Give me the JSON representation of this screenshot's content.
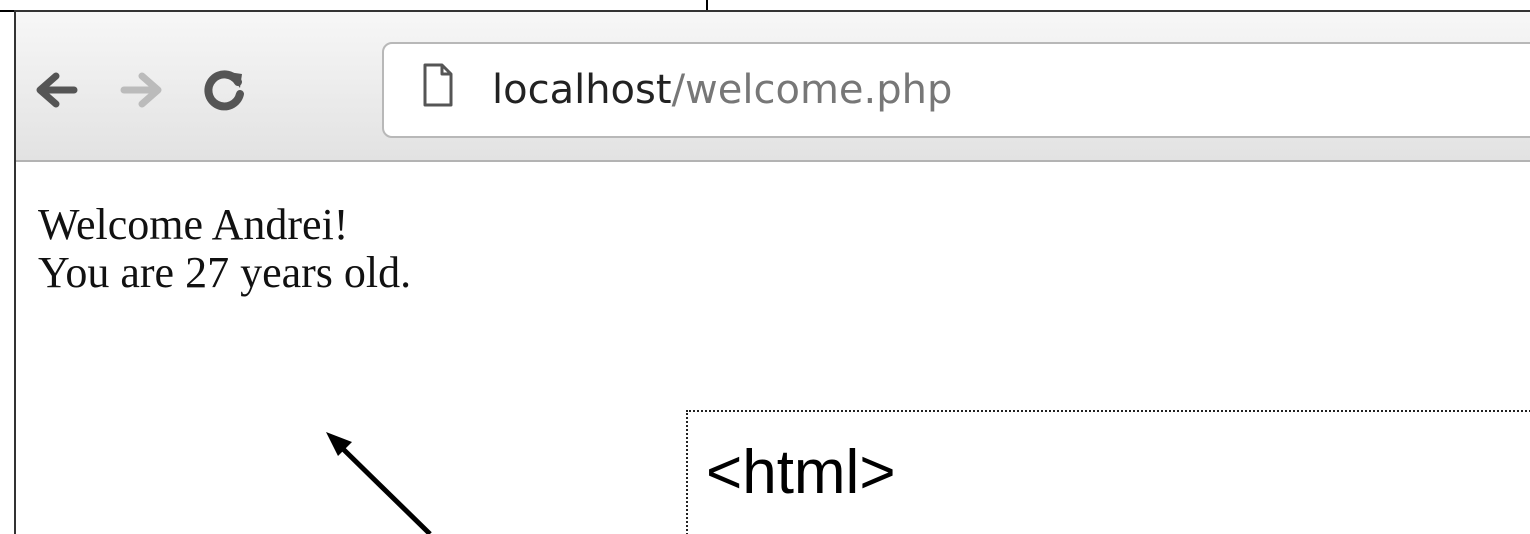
{
  "browser": {
    "url_host": "localhost",
    "url_path": "/welcome.php"
  },
  "page": {
    "line1": "Welcome Andrei!",
    "line2": "You are 27 years old."
  },
  "annotation": {
    "code": "<html>"
  },
  "icons": {
    "back": "back-arrow-icon",
    "forward": "forward-arrow-icon",
    "reload": "reload-icon",
    "page": "page-icon"
  },
  "colors": {
    "toolbar_top": "#f7f7f7",
    "toolbar_bottom": "#e2e2e2",
    "url_path": "#777777",
    "url_host": "#222222"
  }
}
